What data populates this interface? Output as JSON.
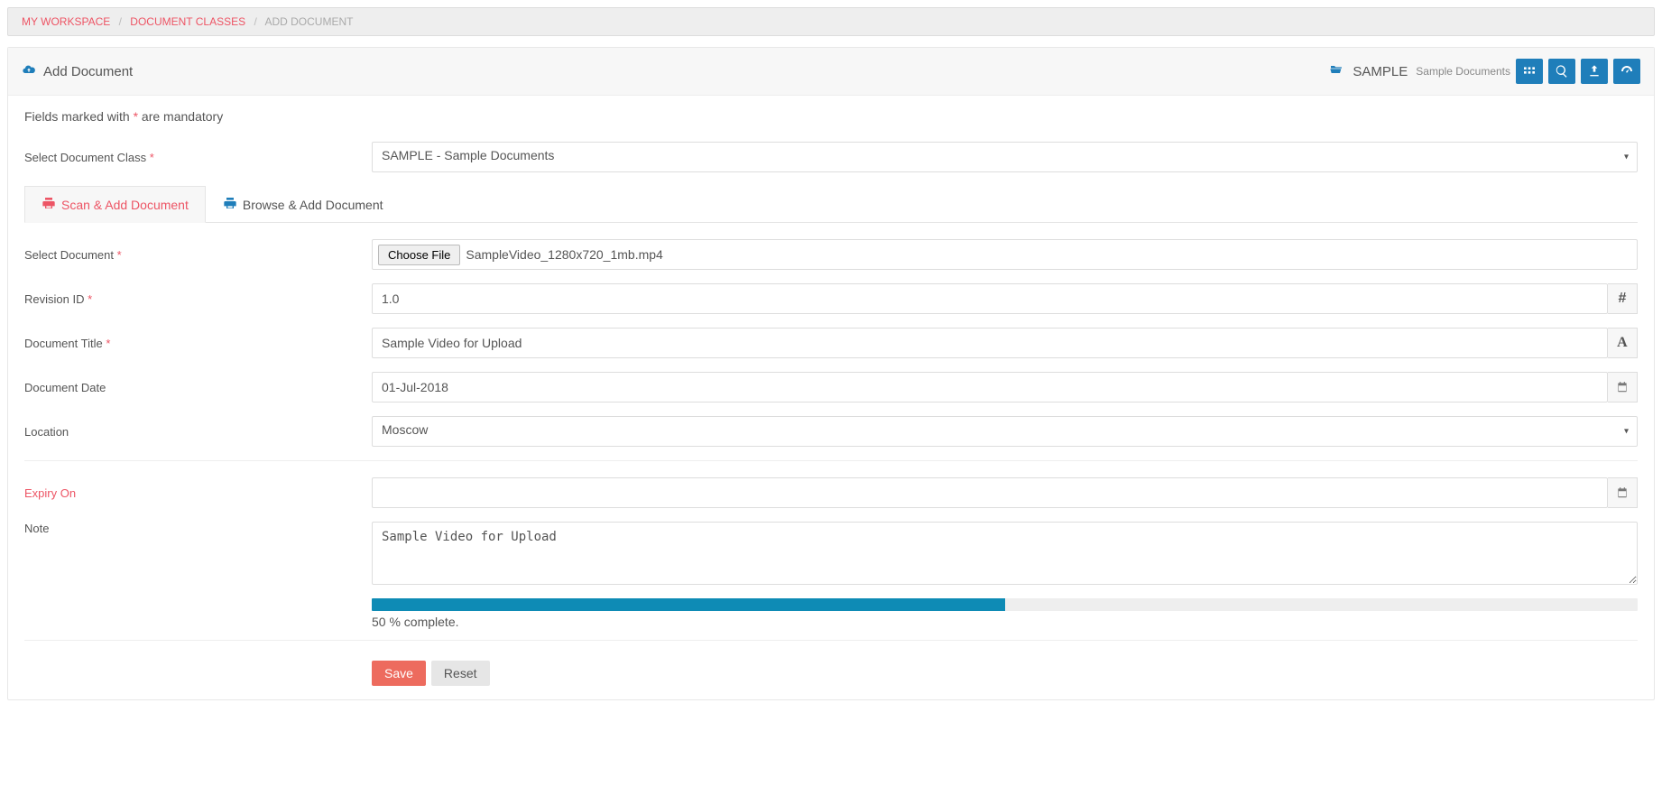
{
  "breadcrumb": {
    "items": [
      "MY WORKSPACE",
      "DOCUMENT CLASSES",
      "ADD DOCUMENT"
    ]
  },
  "header": {
    "title": "Add Document",
    "class_code": "SAMPLE",
    "class_desc": "Sample Documents"
  },
  "form": {
    "hint_prefix": "Fields marked with ",
    "hint_marker": "*",
    "hint_suffix": " are mandatory",
    "labels": {
      "doc_class": "Select Document Class",
      "select_doc": "Select Document",
      "revision": "Revision ID",
      "title": "Document Title",
      "date": "Document Date",
      "location": "Location",
      "expiry": "Expiry On",
      "note": "Note"
    },
    "values": {
      "doc_class": "SAMPLE - Sample Documents",
      "choose_file_label": "Choose File",
      "file_name": "SampleVideo_1280x720_1mb.mp4",
      "revision": "1.0",
      "title": "Sample Video for Upload",
      "date": "01-Jul-2018",
      "location": "Moscow",
      "expiry": "",
      "note": "Sample Video for Upload"
    },
    "tabs": {
      "scan": "Scan & Add Document",
      "browse": "Browse & Add Document"
    },
    "progress": {
      "percent": 50,
      "text": "50 % complete."
    },
    "buttons": {
      "save": "Save",
      "reset": "Reset"
    }
  }
}
